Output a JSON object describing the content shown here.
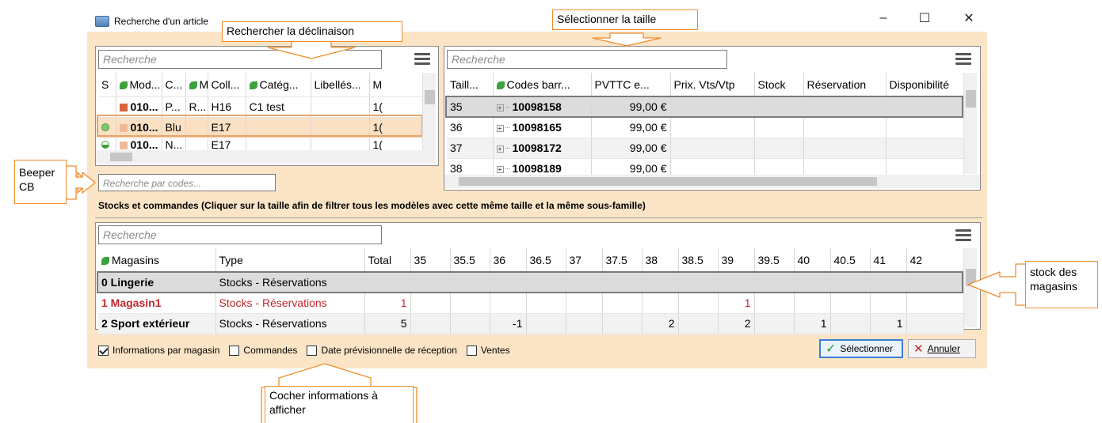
{
  "window": {
    "title": "Recherche d'un article",
    "controls": {
      "minimize": "–",
      "maximize": "☐",
      "close": "✕"
    }
  },
  "left_panel": {
    "search_placeholder": "Recherche",
    "columns": [
      "S",
      "Mod...",
      "C...",
      "M",
      "Coll...",
      "Catég...",
      "Libellés...",
      "M"
    ],
    "rows": [
      {
        "model": "010...",
        "c": "P...",
        "m": "R...",
        "coll": "H16",
        "categ": "C1 test",
        "lib": "",
        "last": "1("
      },
      {
        "model": "010...",
        "c": "Blu",
        "m": "",
        "coll": "E17",
        "categ": "",
        "lib": "",
        "last": "1("
      },
      {
        "model": "010...",
        "c": "N...",
        "m": "",
        "coll": "E17",
        "categ": "",
        "lib": "",
        "last": "1("
      }
    ],
    "barcode_placeholder": "Recherche par codes..."
  },
  "right_panel": {
    "search_placeholder": "Recherche",
    "columns": [
      "Taill...",
      "Codes barr...",
      "PVTTC e...",
      "Prix. Vts/Vtp",
      "Stock",
      "Réservation",
      "Disponibilité"
    ],
    "rows": [
      {
        "size": "35",
        "code": "10098158",
        "price": "99,00 €"
      },
      {
        "size": "36",
        "code": "10098165",
        "price": "99,00 €"
      },
      {
        "size": "37",
        "code": "10098172",
        "price": "99,00 €"
      },
      {
        "size": "38",
        "code": "10098189",
        "price": "99,00 €"
      }
    ]
  },
  "stocks_section": {
    "title": "Stocks et commandes  (Cliquer sur la taille afin de filtrer tous les modèles avec cette même taille et la même sous-famille)",
    "search_placeholder": "Recherche",
    "columns": [
      "Magasins",
      "Type",
      "Total",
      "35",
      "35.5",
      "36",
      "36.5",
      "37",
      "37.5",
      "38",
      "38.5",
      "39",
      "39.5",
      "40",
      "40.5",
      "41",
      "42"
    ],
    "rows": [
      {
        "store": "0 Lingerie",
        "type": "Stocks - Réservations",
        "cells": [
          "",
          "",
          "",
          "",
          "",
          "",
          "",
          "",
          "",
          "",
          "",
          "",
          "",
          "",
          ""
        ]
      },
      {
        "store": "1 Magasin1",
        "type": "Stocks - Réservations",
        "cells": [
          "1",
          "",
          "",
          "",
          "",
          "",
          "",
          "",
          "",
          "1",
          "",
          "",
          "",
          "",
          ""
        ]
      },
      {
        "store": "2 Sport extérieur",
        "type": "Stocks - Réservations",
        "cells": [
          "5",
          "",
          "",
          "-1",
          "",
          "",
          "",
          "2",
          "",
          "2",
          "",
          "1",
          "",
          "1",
          ""
        ]
      }
    ]
  },
  "options": {
    "info_per_store": {
      "label": "Informations par magasin",
      "checked": true
    },
    "orders": {
      "label": "Commandes",
      "checked": false
    },
    "expected_date": {
      "label": "Date prévisionnelle de réception",
      "checked": false
    },
    "sales": {
      "label": "Ventes",
      "checked": false
    }
  },
  "buttons": {
    "select": "Sélectionner",
    "cancel": "Annuler"
  },
  "callouts": {
    "search_variant": "Rechercher la déclinaison",
    "select_size": "Sélectionner la taille",
    "beeper": [
      "Beeper",
      "CB"
    ],
    "store_stock": [
      "stock des",
      "magasins"
    ],
    "check_info": [
      "Cocher informations à",
      "afficher"
    ]
  },
  "colors": {
    "dialog_bg": "#fbe5c6",
    "callout_border": "#f08c2a",
    "accent": "#3b7fd6",
    "red_text": "#c0282e"
  }
}
